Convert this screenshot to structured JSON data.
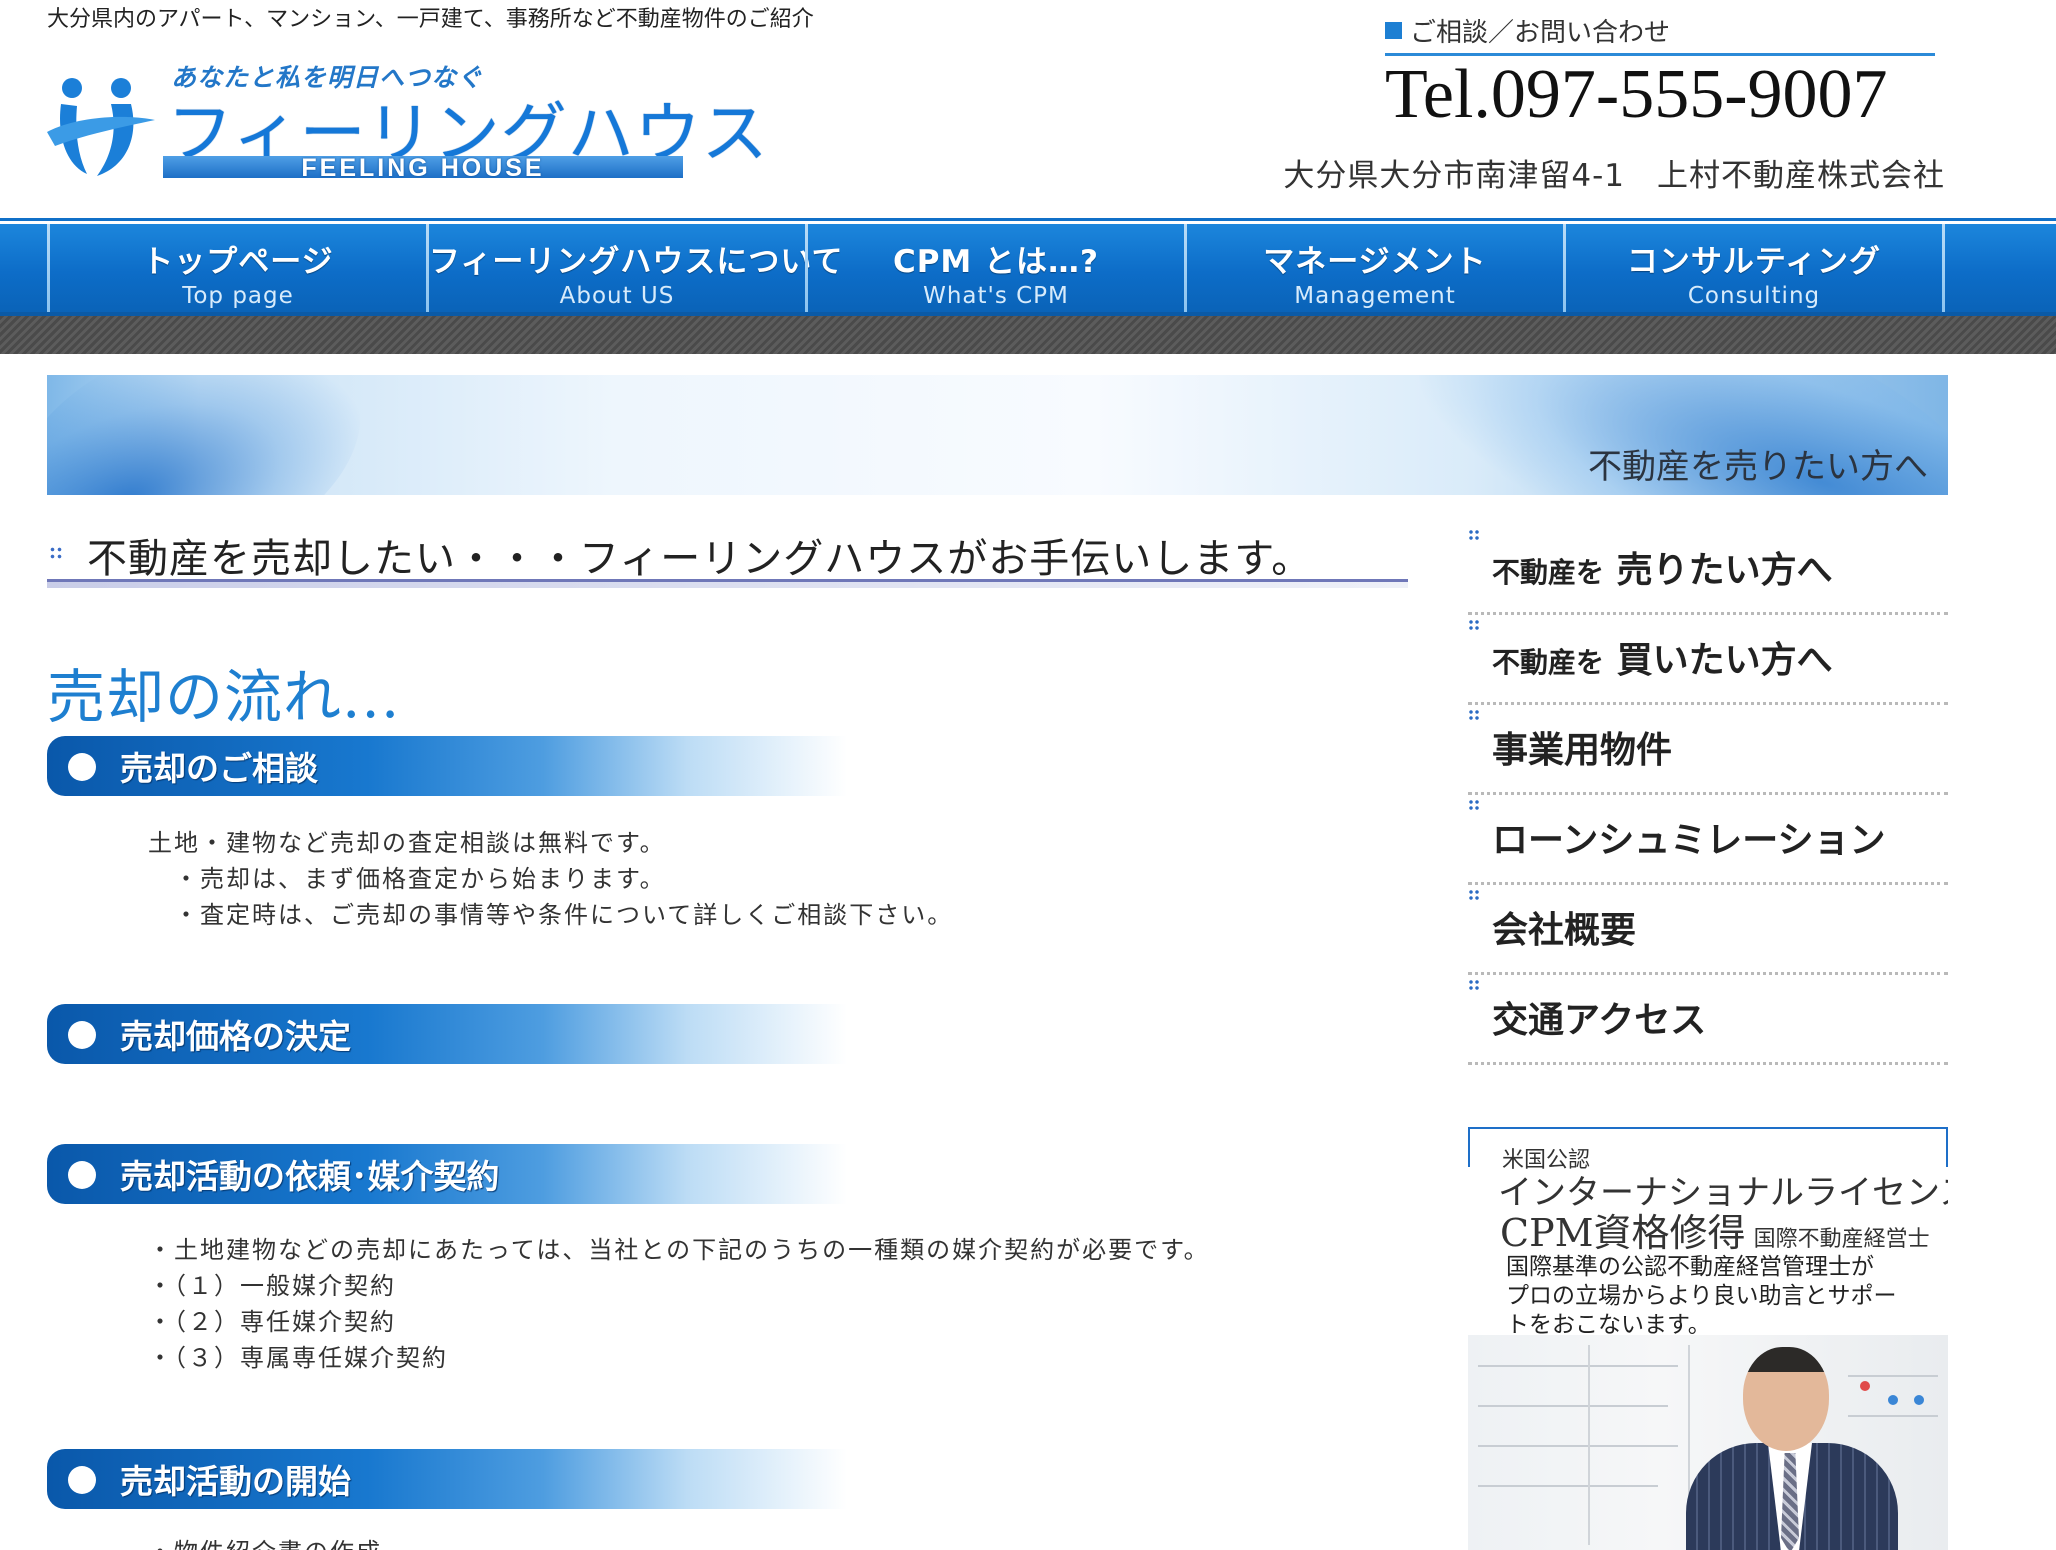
{
  "header": {
    "tagline": "大分県内のアパート、マンション、一戸建て、事務所など不動産物件のご紹介",
    "logo_catch": "あなたと私を明日へつなぐ",
    "logo_name": "フィーリングハウス",
    "logo_en": "FEELING HOUSE",
    "contact_label": "ご相談／お問い合わせ",
    "tel": "Tel.097-555-9007",
    "address": "大分県大分市南津留4-1　上村不動産株式会社"
  },
  "nav": {
    "items": [
      {
        "label": "トップページ",
        "sub": "Top page"
      },
      {
        "label": "フィーリングハウスについて",
        "sub": "About US"
      },
      {
        "label": "CPM とは…?",
        "sub": "What's CPM"
      },
      {
        "label": "マネージメント",
        "sub": "Management"
      },
      {
        "label": "コンサルティング",
        "sub": "Consulting"
      }
    ]
  },
  "banner": {
    "text": "不動産を売りたい方へ"
  },
  "main": {
    "title": "不動産を売却したい・・・フィーリングハウスがお手伝いします。",
    "flow_heading": "売却の流れ...",
    "steps": [
      {
        "label": "売却のご相談",
        "lines": [
          "土地・建物など売却の査定相談は無料です。",
          "・売却は、まず価格査定から始まります。",
          "・査定時は、ご売却の事情等や条件について詳しくご相談下さい。"
        ]
      },
      {
        "label": "売却価格の決定",
        "lines": []
      },
      {
        "label": "売却活動の依頼･媒介契約",
        "lines": [
          "・土地建物などの売却にあたっては、当社との下記のうちの一種類の媒介契約が必要です。",
          "・（１）一般媒介契約",
          "・（２）専任媒介契約",
          "・（３）専属専任媒介契約"
        ]
      },
      {
        "label": "売却活動の開始",
        "lines": [
          "・物件紹介書の作成"
        ]
      }
    ]
  },
  "sidebar": {
    "menu": [
      {
        "prefix": "不動産を",
        "label": "売りたい方へ"
      },
      {
        "prefix": "不動産を",
        "label": "買いたい方へ"
      },
      {
        "prefix": "",
        "label": "事業用物件"
      },
      {
        "prefix": "",
        "label": "ローンシュミレーション"
      },
      {
        "prefix": "",
        "label": "会社概要"
      },
      {
        "prefix": "",
        "label": "交通アクセス"
      }
    ],
    "cpm": {
      "line1": "米国公認",
      "line2": "インターナショナルライセンス",
      "line3": "CPM資格修得",
      "line3_small": "国際不動産経営士",
      "desc1": "国際基準の公認不動産経営管理士が",
      "desc2": "プロの立場からより良い助言とサポー",
      "desc3": "トをおこないます。"
    }
  },
  "colors": {
    "accent_blue": "#1578d8",
    "nav_blue": "#0d6dc8",
    "heading_blue": "#1e7fd0"
  }
}
